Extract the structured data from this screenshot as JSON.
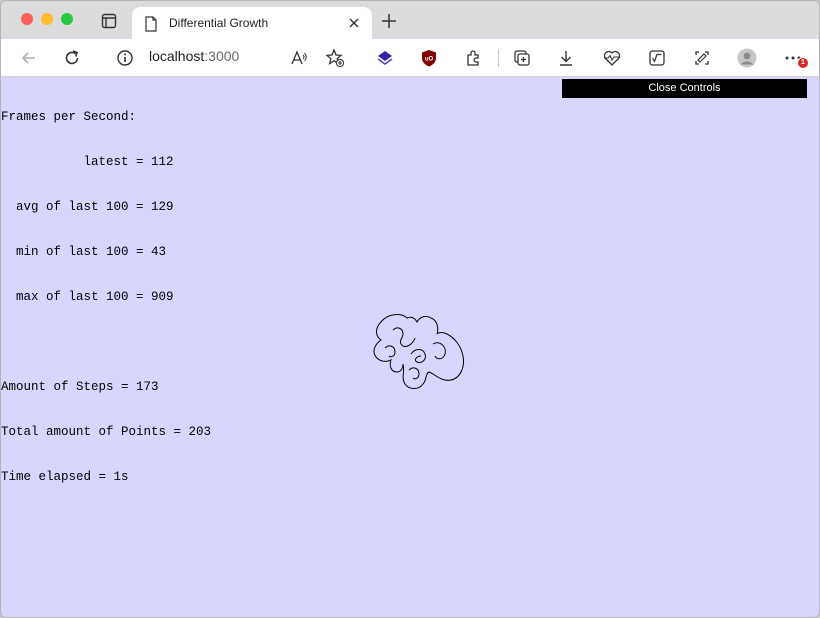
{
  "browser": {
    "tab": {
      "title": "Differential Growth"
    },
    "address": {
      "host": "localhost",
      "port": ":3000"
    },
    "extension_badge": "1"
  },
  "controls": {
    "close_label": "Close Controls"
  },
  "stats": {
    "fps_header": "Frames per Second:",
    "fps_latest": "           latest = 112",
    "fps_avg": "  avg of last 100 = 129",
    "fps_min": "  min of last 100 = 43",
    "fps_max": "  max of last 100 = 909",
    "steps": "Amount of Steps = 173",
    "points": "Total amount of Points = 203",
    "time": "Time elapsed = 1s"
  },
  "colors": {
    "canvas_background": "#d8d6ff",
    "controls_background": "#000000",
    "curve_stroke": "#000000"
  }
}
